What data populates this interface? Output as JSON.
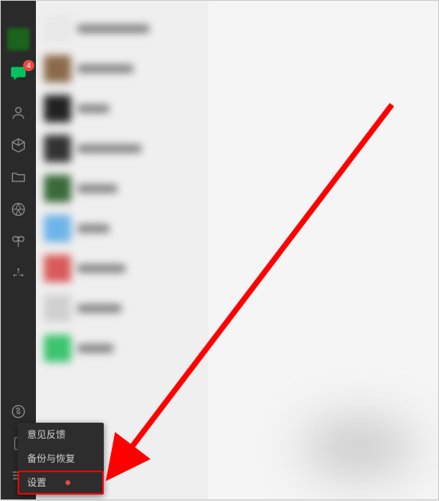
{
  "sidebar": {
    "badge_count": "4"
  },
  "popup": {
    "items": [
      {
        "label": "意见反馈"
      },
      {
        "label": "备份与恢复"
      },
      {
        "label": "设置"
      }
    ]
  },
  "colors": {
    "accent_green": "#07c160",
    "badge_red": "#e54d42",
    "annotation_red": "#ff0000"
  }
}
